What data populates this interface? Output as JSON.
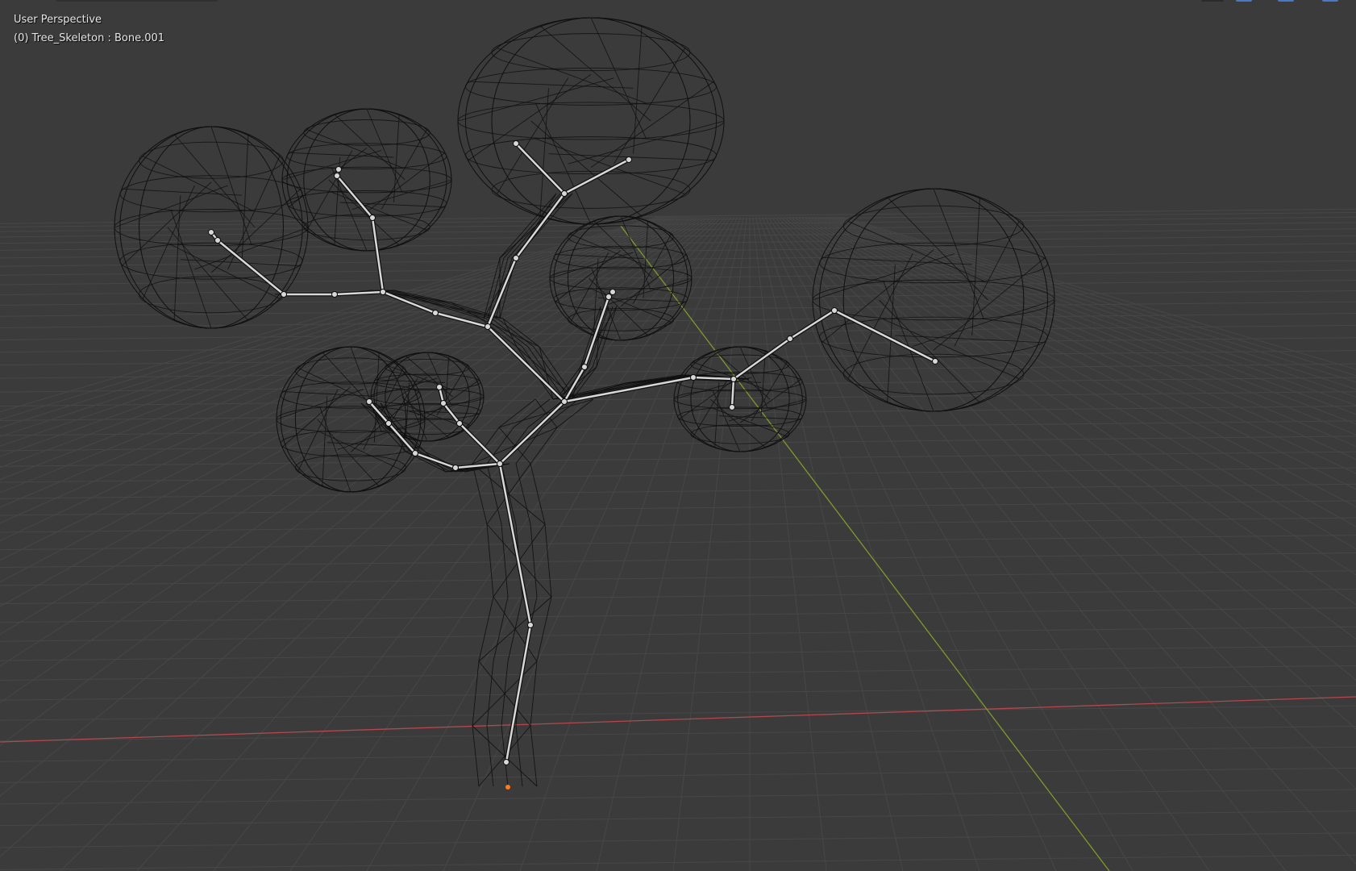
{
  "viewport": {
    "view_name": "User Perspective",
    "object_info": "(0) Tree_Skeleton : Bone.001"
  },
  "colors": {
    "background": "#3b3b3b",
    "grid": "#474747",
    "x_axis": "#b5474f",
    "y_axis": "#7f9a2c",
    "wire": "#101010",
    "bone": "#d8d8d8",
    "origin": "#ff7a1a",
    "header_accent": "#4a77c8"
  }
}
